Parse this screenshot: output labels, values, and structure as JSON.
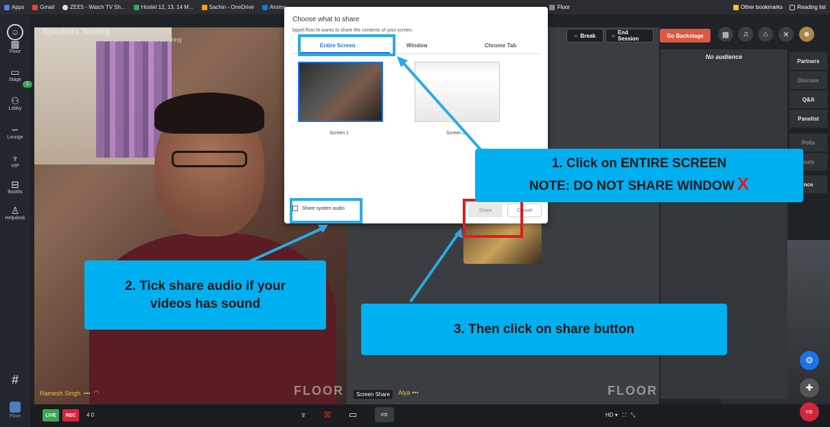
{
  "bookmarks": {
    "items": [
      "Apps",
      "Gmail",
      "ZEE5 - Watch TV Sh...",
      "Hostel 12, 13, 14 M...",
      "Sachin - OneDrive",
      "Aroma"
    ],
    "floor": "Floor",
    "other": "Other bookmarks",
    "reading": "Reading list"
  },
  "nav": {
    "items": [
      "Floor",
      "Stage",
      "Lobby",
      "Lounge",
      "VIP",
      "Booths",
      "Helpdesk"
    ],
    "stage_badge": "1",
    "hash": "#",
    "bottom_label": "Floor"
  },
  "event": {
    "title": "Speakers Testing",
    "subtitle": "World Congress on Micro and Nano Manufacturing"
  },
  "controls": {
    "break": "Break",
    "end_session": "End Session",
    "go_backstage": "Go Backstage"
  },
  "right_panel": {
    "no_audience": "No audience",
    "tabs": [
      "Partners",
      "Discuss",
      "Q&A",
      "Panelist",
      "Polls",
      "outs",
      "nce"
    ]
  },
  "videos": {
    "left_name": "Ramesh Singh",
    "right_name": "Alya",
    "watermark": "FLOOR",
    "screen_share_tag": "Screen Share"
  },
  "bottom": {
    "live": "LIVE",
    "rec": "REC",
    "counts": "4  0",
    "hd": "HD"
  },
  "dialog": {
    "title": "Choose what to share",
    "subtitle": "bquel.floor.ht wants to share the contents of your screen.",
    "tabs": [
      "Entire Screen",
      "Window",
      "Chrome Tab"
    ],
    "screens": [
      "Screen 1",
      "Screen 2"
    ],
    "share_audio": "Share system audio",
    "share": "Share",
    "cancel": "Cancel"
  },
  "callouts": {
    "c1_line1": "1. Click on ENTIRE SCREEN",
    "c1_line2": "NOTE: DO NOT SHARE WINDOW",
    "c1_x": "X",
    "c2_line1": "2. Tick share audio if your",
    "c2_line2": "videos has sound",
    "c3": "3. Then click on share button"
  },
  "colors": {
    "callout": "#00b0f0",
    "highlight": "#29abe2",
    "red": "#e01b1b",
    "backstage": "#d95a3f"
  }
}
